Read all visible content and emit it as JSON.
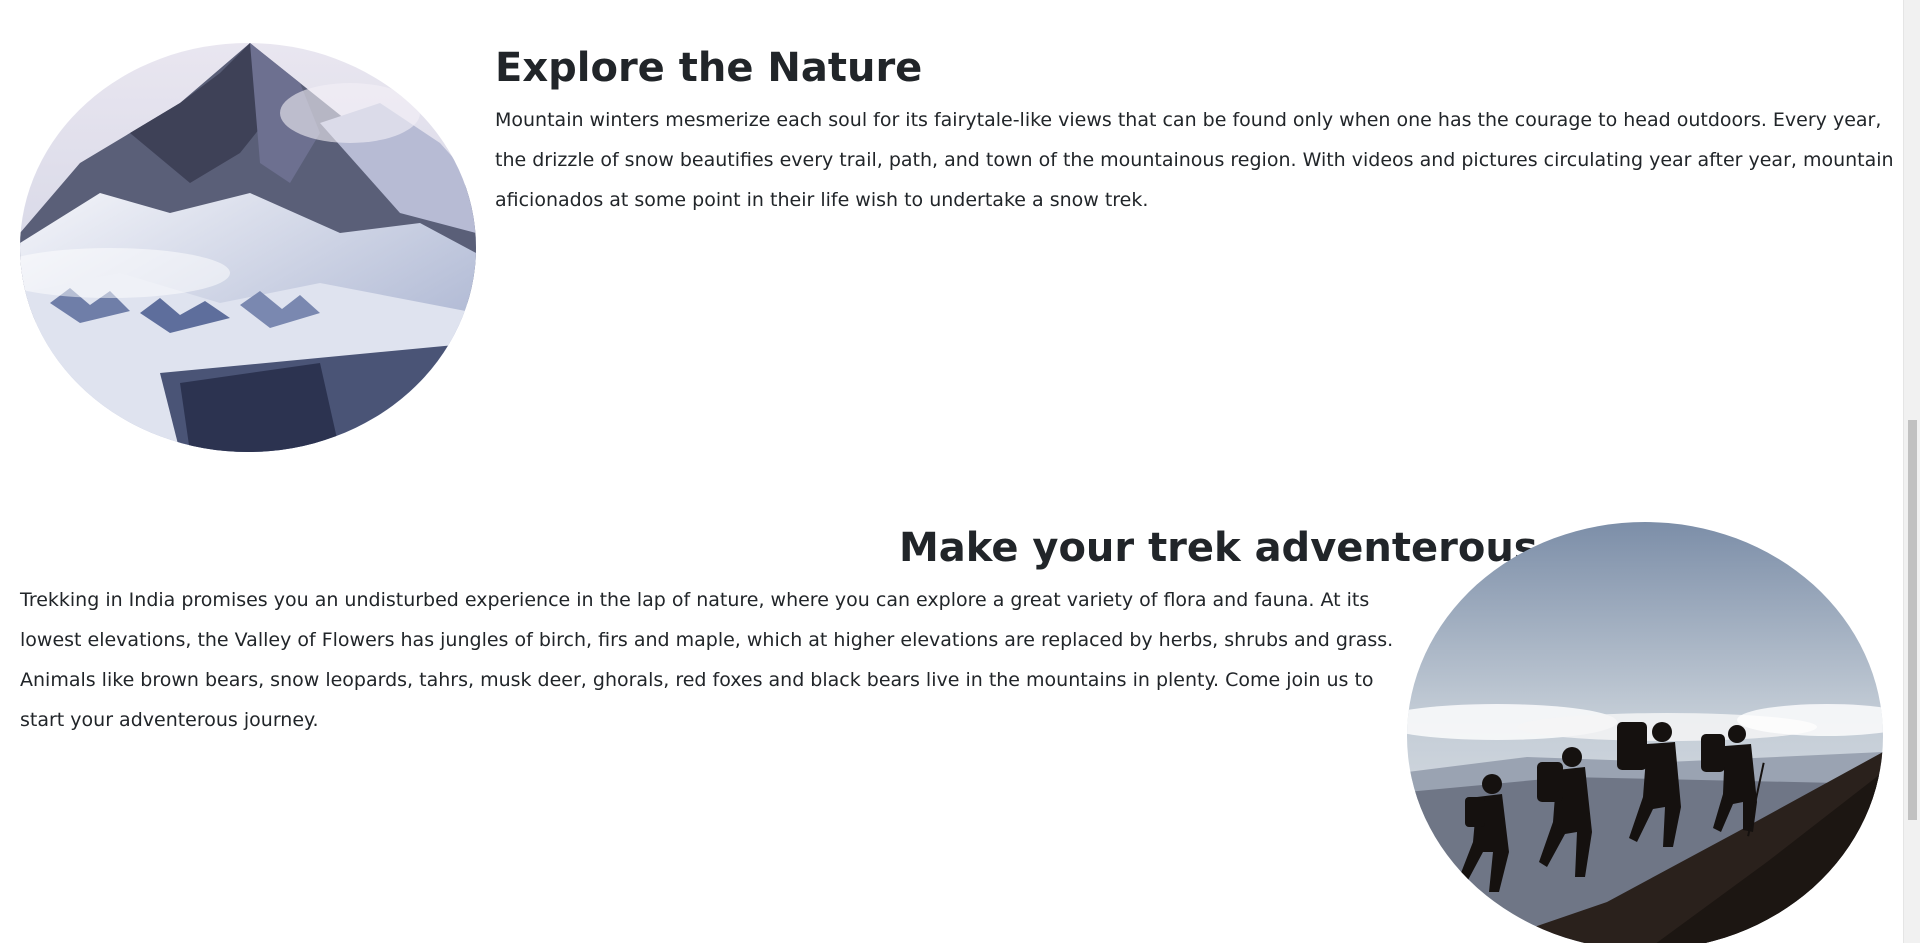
{
  "sections": [
    {
      "title": "Explore the Nature",
      "body": "Mountain winters mesmerize each soul for its fairytale-like views that can be found only when one has the courage to head outdoors. Every year, the drizzle of snow beautifies every trail, path, and town of the mountainous region. With videos and pictures circulating year after year, mountain aficionados at some point in their life wish to undertake a snow trek.",
      "image": "snowy-mountain-landscape"
    },
    {
      "title": "Make your trek adventerous",
      "body": "Trekking in India promises you an undisturbed experience in the lap of nature, where you can explore a great variety of flora and fauna. At its lowest elevations, the Valley of Flowers has jungles of birch, firs and maple, which at higher elevations are replaced by herbs, shrubs and grass. Animals like brown bears, snow leopards, tahrs, musk deer, ghorals, red foxes and black bears live in the mountains in plenty. Come join us to start your adventerous journey.",
      "image": "hikers-silhouette-on-ridge"
    }
  ],
  "colors": {
    "text": "#212529",
    "background": "#ffffff",
    "scrollbar_track": "#f1f1f1",
    "scrollbar_thumb": "#c1c1c1"
  }
}
